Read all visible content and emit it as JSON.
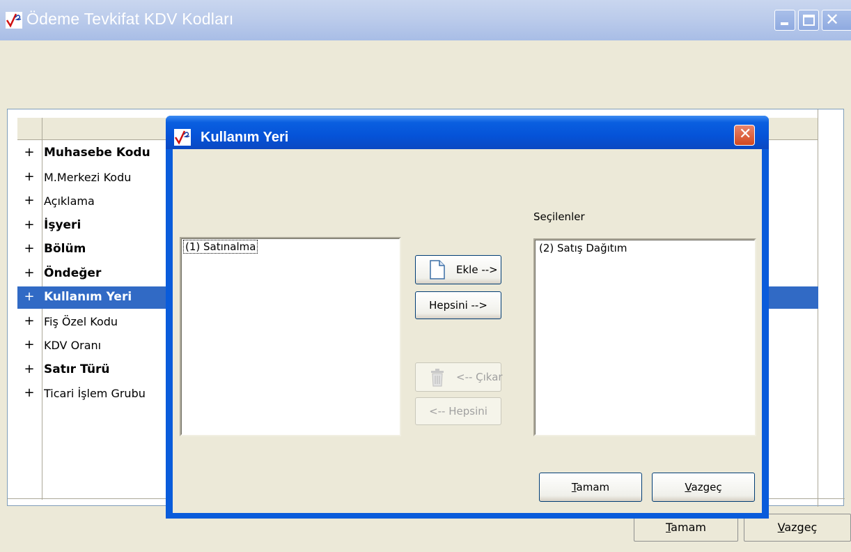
{
  "main_window": {
    "title": "Ödeme Tevkifat KDV Kodları",
    "tree_items": [
      {
        "label": "Muhasebe Kodu",
        "bold": true
      },
      {
        "label": "M.Merkezi Kodu",
        "bold": false
      },
      {
        "label": "Açıklama",
        "bold": false
      },
      {
        "label": "İşyeri",
        "bold": true
      },
      {
        "label": "Bölüm",
        "bold": true
      },
      {
        "label": "Öndeğer",
        "bold": true
      },
      {
        "label": "Kullanım Yeri",
        "bold": true,
        "selected": true
      },
      {
        "label": "Fiş Özel Kodu",
        "bold": false
      },
      {
        "label": "KDV Oranı",
        "bold": false
      },
      {
        "label": "Satır Türü",
        "bold": true
      },
      {
        "label": "Ticari İşlem Grubu",
        "bold": false
      }
    ],
    "expand_symbol": "+",
    "ok_label": {
      "mnemonic": "T",
      "rest": "amam"
    },
    "cancel_label": {
      "mnemonic": "V",
      "rest": "azgeç"
    }
  },
  "dialog": {
    "title": "Kullanım Yeri",
    "available_items": [
      "(1) Satınalma"
    ],
    "selected_header": "Seçilenler",
    "selected_items": [
      "(2) Satış Dağıtım"
    ],
    "add_label": "Ekle -->",
    "add_all_label": "Hepsini -->",
    "remove_label": "<-- Çıkar",
    "remove_all_label": "<-- Hepsini",
    "ok_label": {
      "mnemonic": "T",
      "rest": "amam"
    },
    "cancel_label": {
      "mnemonic": "V",
      "rest": "azgeç"
    }
  },
  "colors": {
    "selection": "#316AC5",
    "dialog_frame": "#0A5CDB",
    "face": "#ECE9D8"
  }
}
